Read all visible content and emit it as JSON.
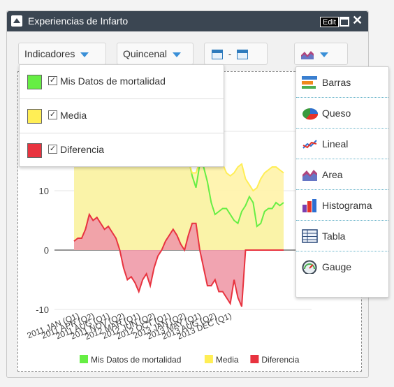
{
  "window": {
    "title": "Experiencias de Infarto",
    "edit_label": "Edit",
    "close_glyph": "✕"
  },
  "toolbar": {
    "indicators_label": "Indicadores",
    "period_label": "Quincenal",
    "date_separator": "-",
    "accent": "#3a8fd7"
  },
  "indicator_menu": {
    "items": [
      {
        "label": "Mis Datos de mortalidad",
        "checked": true,
        "color": "#66ee44"
      },
      {
        "label": "Media",
        "checked": true,
        "color": "#ffee55"
      },
      {
        "label": "Diferencia",
        "checked": true,
        "color": "#e8333f"
      }
    ]
  },
  "chart_type_menu": {
    "items": [
      {
        "label": "Barras",
        "icon": "bar-chart-icon"
      },
      {
        "label": "Queso",
        "icon": "pie-chart-icon"
      },
      {
        "label": "Lineal",
        "icon": "line-chart-icon"
      },
      {
        "label": "Area",
        "icon": "area-chart-icon"
      },
      {
        "label": "Histograma",
        "icon": "histogram-icon"
      },
      {
        "label": "Tabla",
        "icon": "table-icon"
      },
      {
        "label": "Gauge",
        "icon": "gauge-icon"
      }
    ]
  },
  "chart_data": {
    "type": "area",
    "ylim": [
      -10,
      30
    ],
    "yticks": [
      -10,
      0,
      10,
      20
    ],
    "visible_xlim": [
      27,
      137
    ],
    "categories": [
      "2011 JAN (Q1)",
      "2011 APR (Q2)",
      "2011 AUG (Q1)",
      "2011 NOV (Q2)",
      "2012 MAR (Q1)",
      "2012 JUN (Q2)",
      "2012 OCT (Q1)",
      "2013 JAN (Q2)",
      "2013 MAY (Q1)",
      "2013 AUG (Q2)",
      "2013 DEC (Q1)"
    ],
    "category_positions": [
      30,
      38,
      46,
      54,
      62,
      70,
      78,
      86,
      94,
      102,
      110
    ],
    "series": [
      {
        "name": "Mis Datos de mortalidad",
        "color": "#66ee44",
        "fill": "#c9f29b",
        "x": [
          27,
          29,
          31,
          33,
          35,
          37,
          39,
          41,
          43,
          45,
          47,
          49,
          51,
          53,
          55,
          57,
          59,
          61,
          63,
          65,
          67,
          69,
          71,
          73,
          75,
          77,
          79,
          81,
          83,
          85,
          87,
          89,
          91,
          93,
          95,
          97,
          99,
          101,
          103,
          105,
          107,
          109,
          111,
          113,
          115,
          117,
          119,
          121,
          123,
          125,
          127,
          129,
          131,
          133,
          135,
          137
        ],
        "values": [
          22,
          22.5,
          24,
          25,
          26,
          26,
          25.5,
          24,
          22.5,
          23,
          24,
          26.5,
          29,
          27,
          25,
          23,
          23.5,
          26,
          25.5,
          27.5,
          26.5,
          23,
          21.5,
          22.5,
          25,
          23.5,
          22,
          20.5,
          18.5,
          16.5,
          15.5,
          12.5,
          10.5,
          14.5,
          14,
          11.5,
          8,
          6,
          6.5,
          7,
          7,
          6,
          5,
          4.5,
          6.5,
          7.5,
          9,
          8,
          4,
          4.5,
          6.5,
          7,
          7,
          8,
          7.5,
          8
        ]
      },
      {
        "name": "Media",
        "color": "#ffee55",
        "fill": "#fff3a8",
        "x": [
          27,
          29,
          31,
          33,
          35,
          37,
          39,
          41,
          43,
          45,
          47,
          49,
          51,
          53,
          55,
          57,
          59,
          61,
          63,
          65,
          67,
          69,
          71,
          73,
          75,
          77,
          79,
          81,
          83,
          85,
          87,
          89,
          91,
          93,
          95,
          97,
          99,
          101,
          103,
          105,
          107,
          109,
          111,
          113,
          115,
          117,
          119,
          121,
          123,
          125,
          127,
          129,
          131,
          133,
          135,
          137
        ],
        "values": [
          21,
          20.5,
          20.5,
          20,
          19.5,
          20.5,
          20,
          21,
          21.5,
          22,
          22.5,
          23,
          23.5,
          24,
          24.5,
          25,
          25.5,
          26,
          25.5,
          25,
          24,
          23.5,
          23,
          22.5,
          22,
          21.5,
          21,
          20,
          19,
          17,
          15,
          13,
          13,
          15,
          17,
          15,
          15,
          17,
          16,
          14.5,
          13,
          12.5,
          13,
          14,
          14.5,
          12,
          11,
          10,
          10.5,
          12,
          13,
          13.5,
          14,
          14,
          13.5,
          13
        ]
      },
      {
        "name": "Diferencia",
        "color": "#e8333f",
        "fill": "#ef9aa8",
        "x": [
          27,
          29,
          31,
          33,
          35,
          37,
          39,
          41,
          43,
          45,
          47,
          49,
          51,
          53,
          55,
          57,
          59,
          61,
          63,
          65,
          67,
          69,
          71,
          73,
          75,
          77,
          79,
          81,
          83,
          85,
          87,
          89,
          91,
          93,
          95,
          97,
          99,
          101,
          103,
          105,
          107,
          109,
          111,
          113,
          115,
          117,
          119,
          121,
          123,
          125,
          127,
          129,
          131,
          133,
          135,
          137
        ],
        "values": [
          1.5,
          2,
          2,
          3.5,
          6,
          5,
          5.5,
          4.5,
          3.5,
          4,
          3,
          2,
          0,
          -3,
          -5,
          -4.5,
          -5.5,
          -7,
          -5,
          -4,
          -6,
          -3,
          -1,
          0,
          1.5,
          2.5,
          3.5,
          2.5,
          1,
          0,
          2.5,
          4.5,
          4.5,
          0,
          -3,
          -6,
          -6,
          -5,
          -7,
          -7,
          -8,
          -9,
          -5,
          -8,
          -9.5,
          0,
          0,
          0,
          0,
          0,
          0,
          0,
          0,
          0,
          0,
          0
        ]
      }
    ]
  }
}
